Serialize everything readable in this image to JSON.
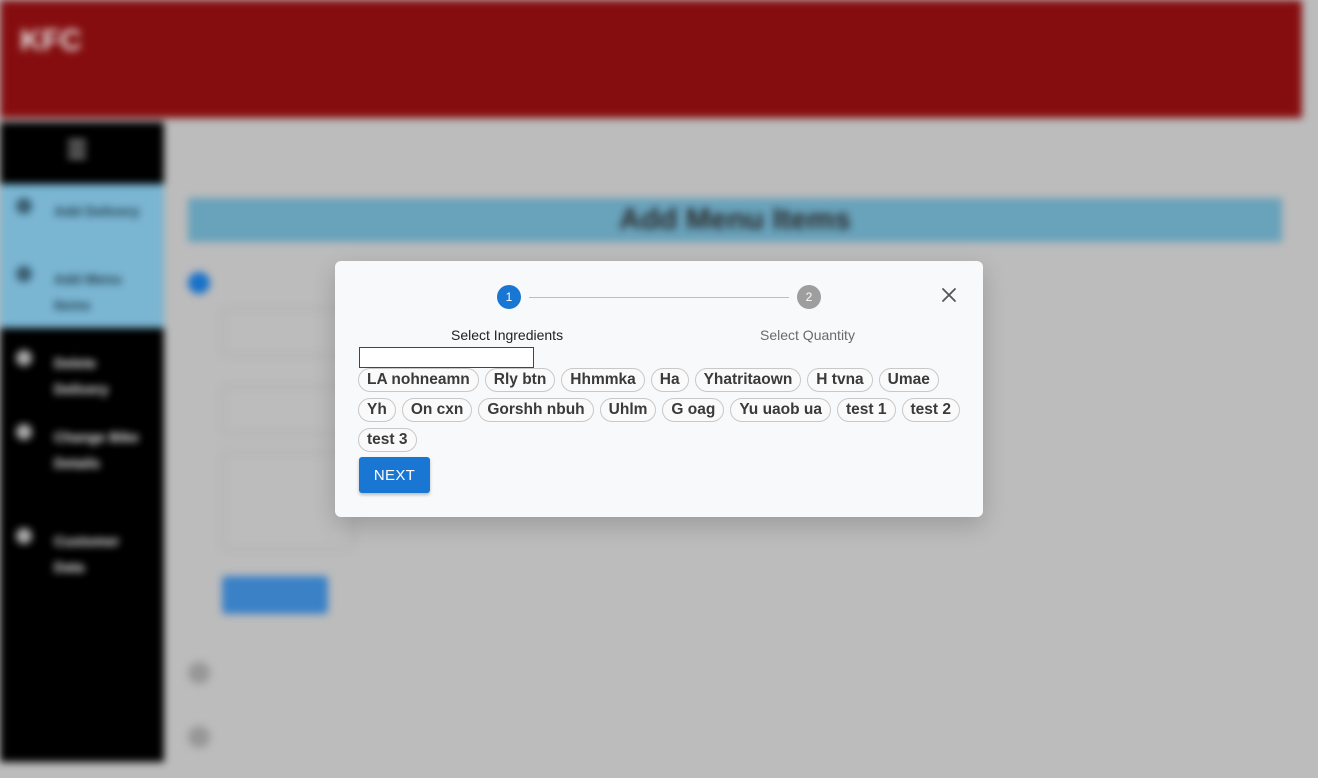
{
  "app": {
    "brand": "KFC"
  },
  "background": {
    "page_title": "Add Menu Items",
    "sidebar_items": [
      {
        "label": "Add Delivery",
        "active": true
      },
      {
        "label": "Add Menu Items",
        "active": true
      },
      {
        "label": "Delete Delivery",
        "active": false
      },
      {
        "label": "Change Bike Details",
        "active": false
      },
      {
        "label": "Customer Data",
        "active": false
      }
    ]
  },
  "dialog": {
    "steps": [
      {
        "number": "1",
        "label": "Select Ingredients",
        "active": true
      },
      {
        "number": "2",
        "label": "Select Quantity",
        "active": false
      }
    ],
    "search": {
      "value": "",
      "placeholder": ""
    },
    "ingredients": [
      "LA nohneamn",
      "Rly btn",
      "Hhmmka",
      "Ha",
      "Yhatritaown",
      "H tvna",
      "Umae",
      "Yh",
      "On cxn",
      "Gorshh nbuh",
      "Uhlm",
      "G oag",
      "Yu uaob ua",
      "test 1",
      "test 2",
      "test 3"
    ],
    "next_label": "NEXT",
    "close_icon": "close-icon"
  },
  "colors": {
    "header": "#8b0e10",
    "active_step": "#1976d2",
    "inactive_step": "#9e9e9e",
    "primary_button": "#1976d2"
  }
}
